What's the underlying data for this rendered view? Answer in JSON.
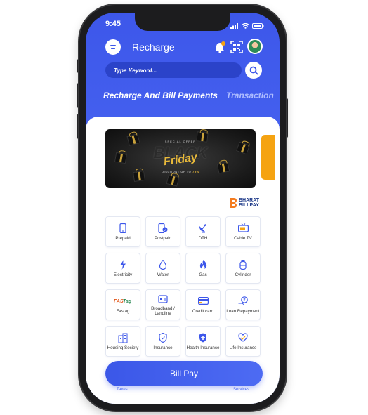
{
  "status_bar": {
    "time": "9:45"
  },
  "header": {
    "title": "Recharge"
  },
  "search": {
    "placeholder": "Type Keyword..."
  },
  "tabs": [
    {
      "label": "Recharge And Bill Payments"
    },
    {
      "label": "Transaction"
    }
  ],
  "banner": {
    "offer_text": "SPECIAL OFFER",
    "headline_1": "BLACK",
    "headline_2": "Friday",
    "discount_prefix": "DISCOUNT UP TO",
    "discount_value": "75%"
  },
  "bbps": {
    "line1": "BHARAT",
    "line2": "BILLPAY"
  },
  "services": [
    {
      "label": "Prepaid",
      "icon": "mobile-icon"
    },
    {
      "label": "Postpaid",
      "icon": "postpaid-mobile-icon"
    },
    {
      "label": "DTH",
      "icon": "satellite-dish-icon"
    },
    {
      "label": "Cable TV",
      "icon": "tv-icon"
    },
    {
      "label": "Electricity",
      "icon": "lightning-icon"
    },
    {
      "label": "Water",
      "icon": "water-drop-icon"
    },
    {
      "label": "Gas",
      "icon": "flame-icon"
    },
    {
      "label": "Cylinder",
      "icon": "cylinder-icon"
    },
    {
      "label": "Fastag",
      "icon": "fastag-logo-icon"
    },
    {
      "label": "Broadband / Landline",
      "icon": "router-icon"
    },
    {
      "label": "Credit card",
      "icon": "credit-card-icon"
    },
    {
      "label": "Loan Repayment",
      "icon": "loan-icon"
    },
    {
      "label": "Housing Society",
      "icon": "building-icon"
    },
    {
      "label": "Insurance",
      "icon": "shield-icon"
    },
    {
      "label": "Health Insurance",
      "icon": "health-shield-icon"
    },
    {
      "label": "Life Insurance",
      "icon": "life-insurance-icon"
    }
  ],
  "row5_partial": [
    "Taxes",
    "Services"
  ],
  "bill_pay": {
    "label": "Bill Pay"
  },
  "colors": {
    "primary": "#3d57ea",
    "accent": "#f5a312",
    "gold": "#e8b93a"
  }
}
